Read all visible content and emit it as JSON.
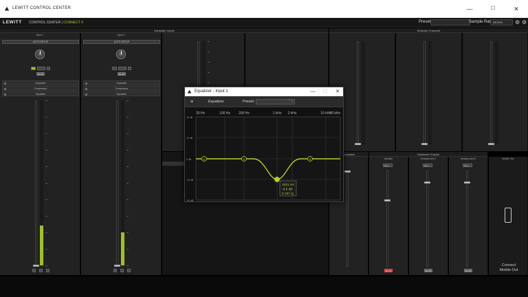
{
  "window": {
    "title": "LEWITT CONTROL CENTER",
    "minimize": "—",
    "maximize": "☐",
    "close": "✕"
  },
  "app": {
    "brand": "LEWITT",
    "subtitle_left": "CONTROL CENTER |",
    "subtitle_accent": "CONNECT 6",
    "preset_label": "Preset:",
    "sample_rate_label": "Sample Rate:",
    "sample_rate_value": "48 kHz",
    "accent_color": "#9ec31f"
  },
  "sections": {
    "hardware_inputs": "Hardware Inputs",
    "software_channels": "Software Channels",
    "loopback": "Loopback",
    "hardware_outputs": "Hardware Outputs"
  },
  "inputs": [
    {
      "title": "Input 1",
      "auto_setup": "AUTO SETUP",
      "mute": "MUTE",
      "fx": [
        "Expander",
        "Compressor",
        "Equalizer"
      ],
      "level": 0.24
    },
    {
      "title": "Input 2",
      "auto_setup": "AUTO SETUP",
      "mute": "MUTE",
      "fx": [
        "Expander",
        "Compressor",
        "Equalizer"
      ],
      "level": 0.2
    }
  ],
  "outputs": [
    {
      "title": "Speaker",
      "select": "Mix A",
      "mute": "MUTE",
      "muted": true
    },
    {
      "title": "Headphones 1",
      "select": "Mix A",
      "mute": "MUTE",
      "muted": false
    },
    {
      "title": "Headphones 2",
      "select": "Mix A",
      "mute": "MUTE",
      "muted": false
    }
  ],
  "mobile": {
    "title": "Mobile Out",
    "connect_line1": "Connect",
    "connect_line2": "Mobile Out"
  },
  "eq": {
    "title": "Equalizer - Input 1",
    "name": "Equalizer",
    "preset_label": "Preset:",
    "freq_labels": [
      "20 Hz",
      "100 Hz",
      "200 Hz",
      "1 kHz",
      "2 kHz",
      "10 kHz",
      "20 kHz"
    ],
    "gain_labels": [
      "20 dB",
      "10 dB",
      "0 dB",
      "-10 dB",
      "-20 dB"
    ],
    "bands": [
      "1",
      "2",
      "3",
      "4"
    ],
    "tooltip": {
      "freq": "1021 Hz",
      "gain": "-6.9 dB",
      "q": "0.707 Q"
    },
    "curve_color": "#b6cf2a"
  }
}
